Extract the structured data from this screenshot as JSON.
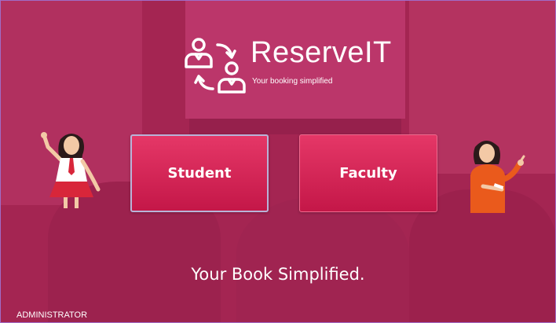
{
  "app": {
    "name": "ReserveIT",
    "tagline": "Your booking simplified",
    "logo_icon": "users-exchange-icon"
  },
  "roles": {
    "student_label": "Student",
    "faculty_label": "Faculty"
  },
  "footer": {
    "slogan": "Your Book Simplified.",
    "admin_label": "ADMINISTRATOR"
  },
  "illustrations": {
    "left": "student-girl-illustration",
    "right": "faculty-teacher-illustration"
  },
  "colors": {
    "overlay": "#c42660",
    "button": "#d92a5a",
    "text": "#ffffff"
  }
}
